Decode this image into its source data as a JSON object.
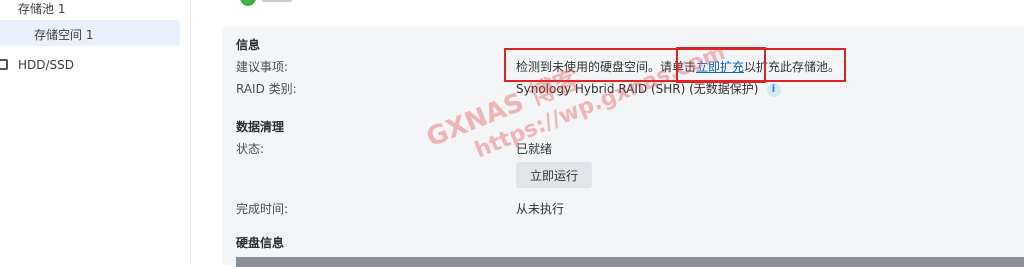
{
  "sidebar": {
    "pool_label": "存储池 1",
    "volume_label": "存储空间 1",
    "hdd_label": "HDD/SSD"
  },
  "info": {
    "section_title": "信息",
    "suggestion_label": "建议事项:",
    "suggestion_before": "检测到未使用的硬盘空间。请单击",
    "suggestion_link": "立即扩充",
    "suggestion_after": "以扩充此存储池。",
    "raid_label": "RAID 类别:",
    "raid_value": "Synology Hybrid RAID (SHR) (无数据保护)",
    "info_icon": "i"
  },
  "scrub": {
    "section_title": "数据清理",
    "status_label": "状态:",
    "status_value": "已就绪",
    "run_button": "立即运行",
    "finish_label": "完成时间:",
    "finish_value": "从未执行"
  },
  "disk": {
    "section_title": "硬盘信息"
  },
  "watermark": {
    "line1": "GXNAS 博客",
    "line2": "https://wp.gxnas.com"
  },
  "colors": {
    "highlight": "#e02424",
    "link": "#0a63c9",
    "selected_nav": "#e8f1fb",
    "status_ok": "#3cb043"
  }
}
